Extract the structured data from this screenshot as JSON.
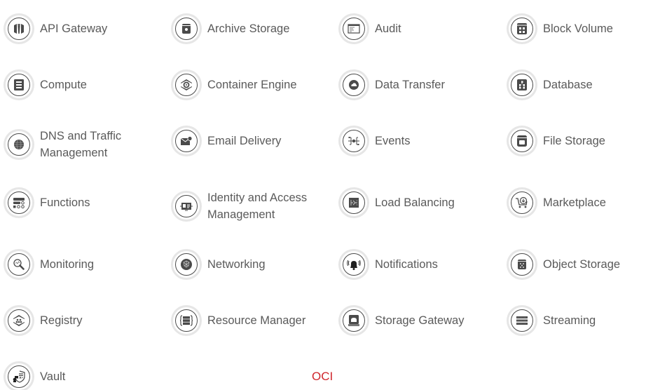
{
  "services": [
    {
      "label": "API Gateway",
      "icon": "api-gateway-icon"
    },
    {
      "label": "Archive Storage",
      "icon": "archive-storage-icon"
    },
    {
      "label": "Audit",
      "icon": "audit-icon"
    },
    {
      "label": "Block Volume",
      "icon": "block-volume-icon"
    },
    {
      "label": "Compute",
      "icon": "compute-icon"
    },
    {
      "label": "Container Engine",
      "icon": "container-engine-icon"
    },
    {
      "label": "Data Transfer",
      "icon": "data-transfer-icon"
    },
    {
      "label": "Database",
      "icon": "database-icon"
    },
    {
      "label": "DNS and Traffic Management",
      "icon": "dns-icon"
    },
    {
      "label": "Email Delivery",
      "icon": "email-delivery-icon"
    },
    {
      "label": "Events",
      "icon": "events-icon"
    },
    {
      "label": "File Storage",
      "icon": "file-storage-icon"
    },
    {
      "label": "Functions",
      "icon": "functions-icon"
    },
    {
      "label": "Identity and Access Management",
      "icon": "identity-access-icon"
    },
    {
      "label": "Load Balancing",
      "icon": "load-balancing-icon"
    },
    {
      "label": "Marketplace",
      "icon": "marketplace-icon"
    },
    {
      "label": "Monitoring",
      "icon": "monitoring-icon"
    },
    {
      "label": "Networking",
      "icon": "networking-icon"
    },
    {
      "label": "Notifications",
      "icon": "notifications-icon"
    },
    {
      "label": "Object Storage",
      "icon": "object-storage-icon"
    },
    {
      "label": "Registry",
      "icon": "registry-icon"
    },
    {
      "label": "Resource Manager",
      "icon": "resource-manager-icon"
    },
    {
      "label": "Storage Gateway",
      "icon": "storage-gateway-icon"
    },
    {
      "label": "Streaming",
      "icon": "streaming-icon"
    },
    {
      "label": "Vault",
      "icon": "vault-icon"
    }
  ],
  "footer": {
    "link_label": "OCI"
  },
  "colors": {
    "text": "#5a5a5a",
    "icon": "#4a4a4a",
    "ring": "#e6e6e6",
    "accent": "#d0262c"
  }
}
